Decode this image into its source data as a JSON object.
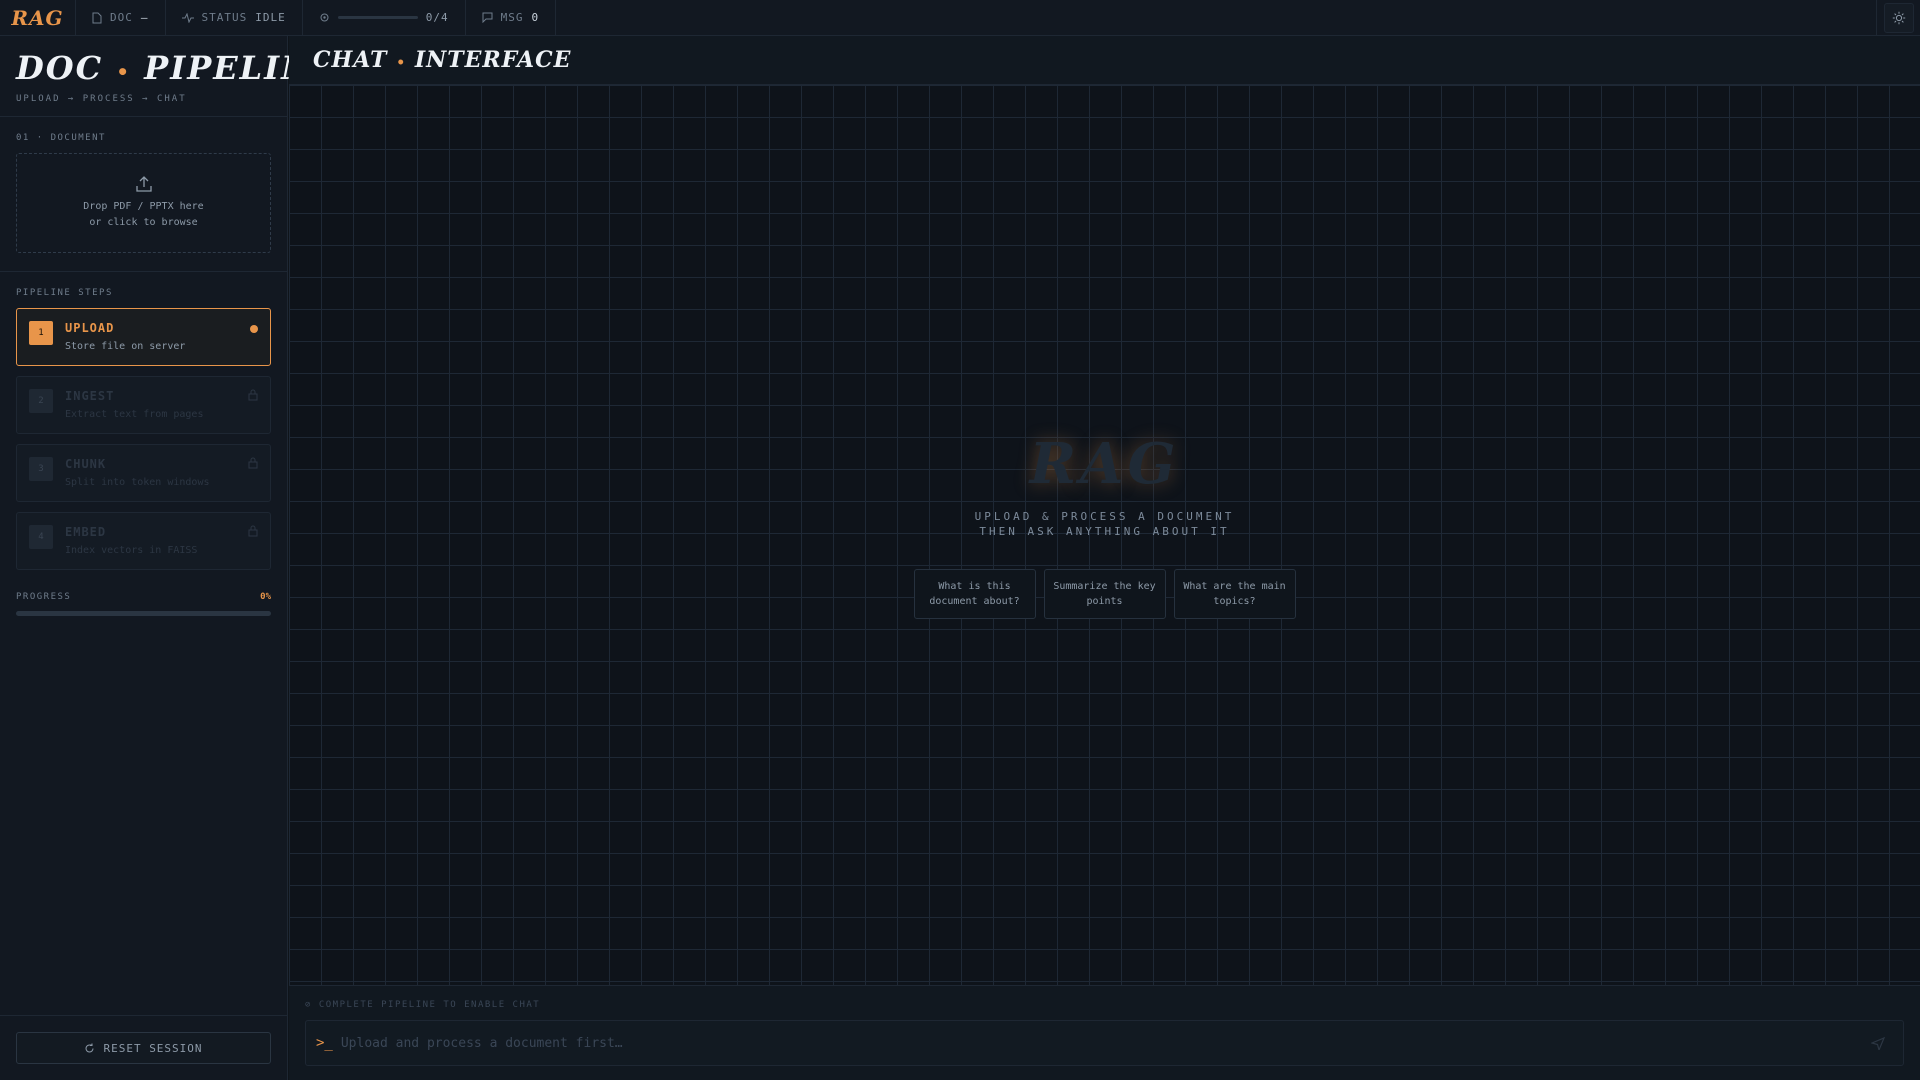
{
  "topbar": {
    "logo": "RAG",
    "doc_label": "DOC",
    "doc_value": "—",
    "status_label": "STATUS",
    "status_value": "IDLE",
    "steps_value": "0/4",
    "msg_label": "MSG",
    "msg_value": "0"
  },
  "sidebar": {
    "title_left": "DOC",
    "title_dot": "•",
    "title_right": "PIPELINE",
    "subtitle": "UPLOAD → PROCESS → CHAT",
    "document_section_label": "01 · DOCUMENT",
    "dropzone_line1": "Drop PDF / PPTX here",
    "dropzone_line2": "or click to browse",
    "steps_label": "PIPELINE STEPS",
    "steps": [
      {
        "num": "1",
        "name": "UPLOAD",
        "desc": "Store file on server"
      },
      {
        "num": "2",
        "name": "INGEST",
        "desc": "Extract text from pages"
      },
      {
        "num": "3",
        "name": "CHUNK",
        "desc": "Split into token windows"
      },
      {
        "num": "4",
        "name": "EMBED",
        "desc": "Index vectors in FAISS"
      }
    ],
    "progress_label": "PROGRESS",
    "progress_value": "0%",
    "progress_fraction": 0,
    "reset_label": "RESET SESSION"
  },
  "main": {
    "title_left": "CHAT",
    "title_dot": "•",
    "title_right": "INTERFACE",
    "empty_logo": "RAG",
    "empty_line1": "UPLOAD & PROCESS A DOCUMENT",
    "empty_line2": "THEN ASK ANYTHING ABOUT IT",
    "suggestions": [
      "What is this document about?",
      "Summarize the key points",
      "What are the main topics?"
    ],
    "hint": "⊘ COMPLETE PIPELINE TO ENABLE CHAT",
    "prompt": ">_",
    "input_placeholder": "Upload and process a document first…"
  },
  "colors": {
    "accent": "#e8954a",
    "background": "#0f141a",
    "panel": "#121821"
  }
}
